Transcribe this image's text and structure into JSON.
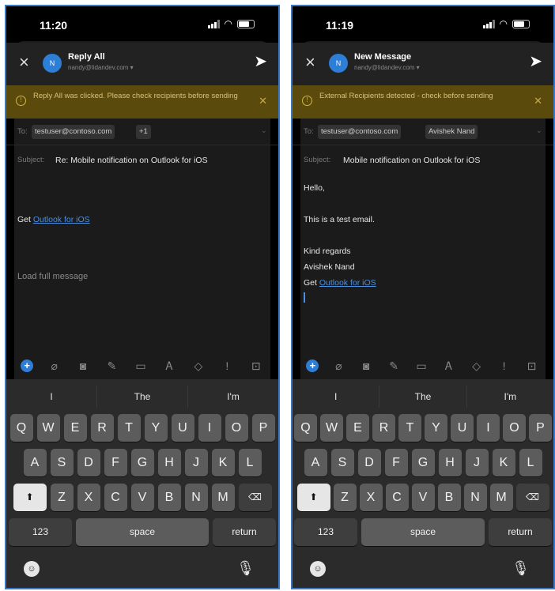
{
  "left": {
    "status_time": "11:20",
    "header_title": "Reply All",
    "header_from": "nandy@lidandev.com ▾",
    "avatar_initial": "N",
    "banner_text": "Reply All was clicked. Please check recipients before sending",
    "to_label": "To:",
    "recipients": [
      "testuser@contoso.com",
      "+1"
    ],
    "subject_label": "Subject:",
    "subject": "Re: Mobile notification on Outlook for iOS",
    "get_prefix": "Get",
    "get_link": "Outlook for iOS",
    "load_full": "Load full message"
  },
  "right": {
    "status_time": "11:19",
    "header_title": "New Message",
    "header_from": "nandy@lidandev.com ▾",
    "avatar_initial": "N",
    "banner_text": "External Recipients detected - check before sending",
    "to_label": "To:",
    "recipients": [
      "testuser@contoso.com",
      "Avishek Nand"
    ],
    "subject_label": "Subject:",
    "subject": "Mobile notification on Outlook for iOS",
    "body_lines": [
      "Hello,",
      "This is a test email.",
      "Kind regards",
      "Avishek Nand"
    ],
    "get_prefix": "Get",
    "get_link": "Outlook for iOS"
  },
  "keyboard": {
    "suggestions": [
      "I",
      "The",
      "I'm"
    ],
    "row1": [
      "Q",
      "W",
      "E",
      "R",
      "T",
      "Y",
      "U",
      "I",
      "O",
      "P"
    ],
    "row2": [
      "A",
      "S",
      "D",
      "F",
      "G",
      "H",
      "J",
      "K",
      "L"
    ],
    "row3": [
      "Z",
      "X",
      "C",
      "V",
      "B",
      "N",
      "M"
    ],
    "key_123": "123",
    "key_space": "space",
    "key_return": "return"
  },
  "colors": {
    "accent": "#2d7ed6",
    "banner_bg": "#5a4a0c",
    "banner_text": "#d9c27a",
    "link": "#4a8fe0",
    "frame_border": "#3b78c4"
  }
}
